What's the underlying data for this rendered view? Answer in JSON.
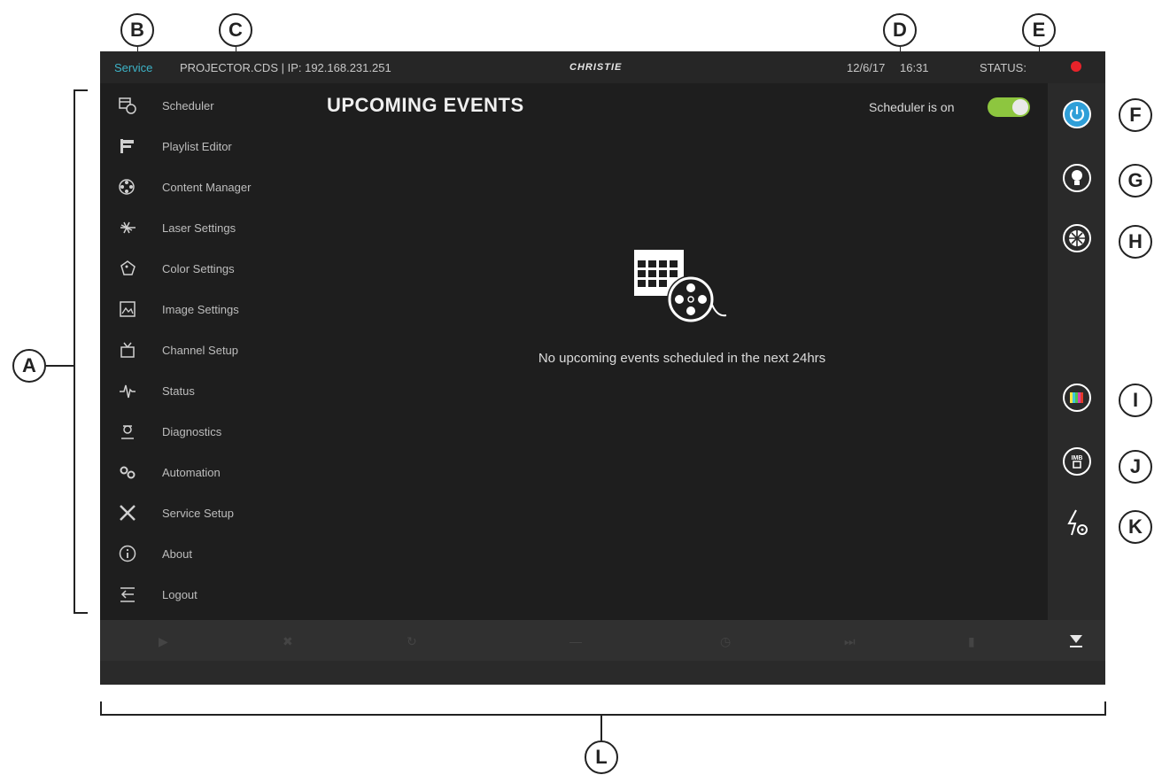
{
  "callouts": {
    "a": "A",
    "b": "B",
    "c": "C",
    "d": "D",
    "e": "E",
    "f": "F",
    "g": "G",
    "h": "H",
    "i": "I",
    "j": "J",
    "k": "K",
    "l": "L"
  },
  "topbar": {
    "mode": "Service",
    "projector": "PROJECTOR.CDS | IP: 192.168.231.251",
    "brand": "CHRISTIE",
    "date": "12/6/17",
    "time": "16:31",
    "status_label": "STATUS:",
    "status_color": "#e8232a"
  },
  "sidebar": {
    "items": [
      {
        "label": "Scheduler",
        "icon": "scheduler-icon"
      },
      {
        "label": "Playlist Editor",
        "icon": "playlist-icon"
      },
      {
        "label": "Content Manager",
        "icon": "film-reel-icon"
      },
      {
        "label": "Laser Settings",
        "icon": "laser-icon"
      },
      {
        "label": "Color Settings",
        "icon": "color-palette-icon"
      },
      {
        "label": "Image Settings",
        "icon": "image-icon"
      },
      {
        "label": "Channel Setup",
        "icon": "tv-icon"
      },
      {
        "label": "Status",
        "icon": "pulse-icon"
      },
      {
        "label": "Diagnostics",
        "icon": "diagnostics-icon"
      },
      {
        "label": "Automation",
        "icon": "gears-icon"
      },
      {
        "label": "Service Setup",
        "icon": "tools-icon"
      },
      {
        "label": "About",
        "icon": "info-icon"
      },
      {
        "label": "Logout",
        "icon": "logout-icon"
      }
    ]
  },
  "main": {
    "title": "UPCOMING EVENTS",
    "scheduler_label": "Scheduler is on",
    "scheduler_on": true,
    "empty_message": "No upcoming events scheduled in the next 24hrs"
  },
  "rail": {
    "buttons": [
      "power-icon",
      "lamp-icon",
      "shutter-icon",
      "test-pattern-icon",
      "imb-icon",
      "power-settings-icon"
    ],
    "accent": "#2f9fd8"
  }
}
